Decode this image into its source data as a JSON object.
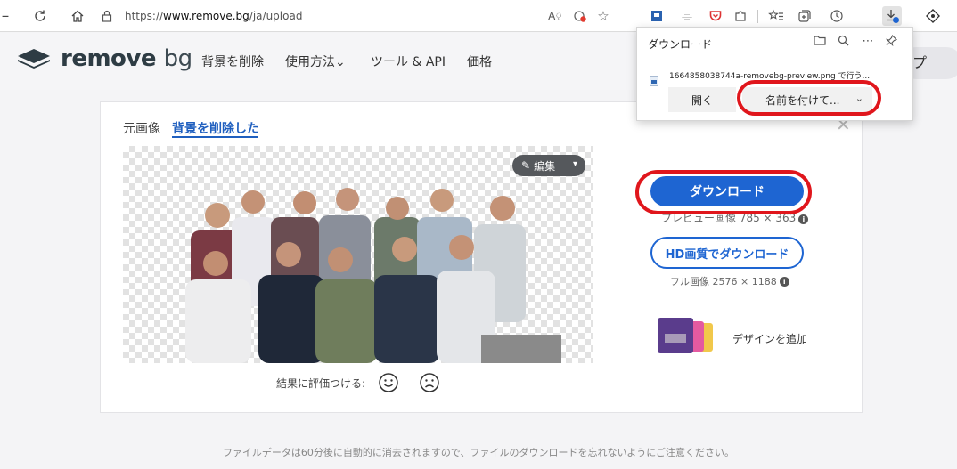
{
  "browser": {
    "url_prefix": "https://",
    "url_host": "www.remove.bg",
    "url_path": "/ja/upload"
  },
  "header": {
    "logo_main": "remove",
    "logo_suffix": "bg",
    "nav": [
      "背景を削除",
      "使用方法⌄",
      "ツール & API",
      "価格"
    ],
    "right_pill_text": "プ"
  },
  "editor": {
    "tab_original": "元画像",
    "tab_removed": "背景を削除した",
    "edit_label": "編集",
    "rating_label": "結果に評価つける:"
  },
  "actions": {
    "download_label": "ダウンロード",
    "preview_caption": "プレビュー画像 785 × 363",
    "hd_label": "HD画質でダウンロード",
    "full_caption": "フル画像 2576 × 1188",
    "design_link": "デザインを追加"
  },
  "footer": {
    "note": "ファイルデータは60分後に自動的に消去されますので、ファイルのダウンロードを忘れないようにご注意ください。"
  },
  "downloads_panel": {
    "title": "ダウンロード",
    "filename": "1664858038744a-removebg-preview.png で行う...",
    "open_label": "開く",
    "save_as_label": "名前を付けて..."
  },
  "colors": {
    "accent_blue": "#1e65d2",
    "highlight_red": "#e0161c"
  }
}
